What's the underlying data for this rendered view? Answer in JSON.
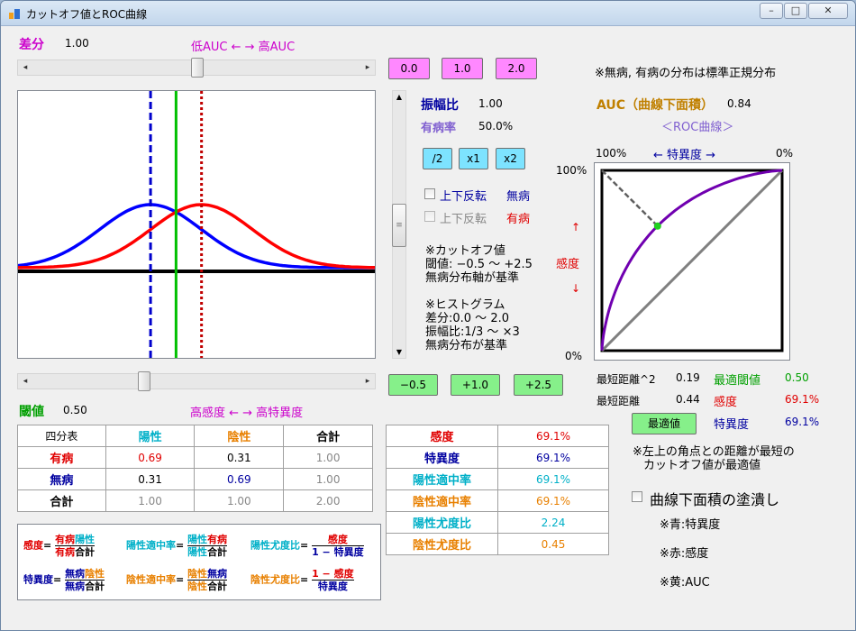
{
  "window": {
    "title": "カットオフ値とROC曲線",
    "min": "▭",
    "max": "▢",
    "close": "✕"
  },
  "diff": {
    "label": "差分",
    "value": "1.00",
    "range": "低AUC ← → 高AUC",
    "buttons": [
      "0.0",
      "1.0",
      "2.0"
    ],
    "slider": 0.5
  },
  "note_dist": "※無病, 有病の分布は標準正規分布",
  "amp": {
    "label": "振幅比",
    "value": "1.00",
    "buttons": [
      "/2",
      "x1",
      "x2"
    ]
  },
  "prev": {
    "label": "有病率",
    "value": "50.0%"
  },
  "flip1": {
    "label": "上下反転",
    "target": "無病"
  },
  "flip2": {
    "label": "上下反転",
    "target": "有病"
  },
  "notes_mid": [
    "※カットオフ値",
    "閾値: −0.5 〜 +2.5",
    "無病分布軸が基準",
    "",
    "※ヒストグラム",
    "差分:0.0 〜 2.0",
    "振幅比:1/3 〜 ×3",
    "無病分布が基準"
  ],
  "threshold": {
    "label": "閾値",
    "value": "0.50",
    "range": "高感度 ← → 高特異度",
    "buttons": [
      "−0.5",
      "+1.0",
      "+2.5"
    ],
    "slider": 0.333
  },
  "auc": {
    "label": "AUC（曲線下面積）",
    "value": "0.84",
    "roc_title": "＜ROC曲線＞"
  },
  "roc": {
    "top_left": "100%",
    "spec_axis": "← 特異度 →",
    "top_right": "0%",
    "y_top": "100%",
    "y_bottom": "0%",
    "sens_axis_up": "↑",
    "sens_axis": "感度",
    "sens_axis_down": "↓",
    "point": {
      "fpr": 0.309,
      "tpr": 0.691
    }
  },
  "stats": {
    "min_dist2_label": "最短距離^2",
    "min_dist2": "0.19",
    "best_thr_label": "最適閾値",
    "best_thr": "0.50",
    "min_dist_label": "最短距離",
    "min_dist": "0.44",
    "sens_label": "感度",
    "sens": "69.1%",
    "best_btn": "最適値",
    "spec_label": "特異度",
    "spec": "69.1%"
  },
  "note_best": [
    "※左上の角点との距離が最短の",
    "カットオフ値が最適値"
  ],
  "fill": {
    "label": "曲線下面積の塗潰し"
  },
  "legend_notes": [
    "※青:特異度",
    "※赤:感度",
    "※黄:AUC"
  ],
  "table4": {
    "header": [
      "四分表",
      "陽性",
      "陰性",
      "合計"
    ],
    "rows": [
      [
        "有病",
        "0.69",
        "0.31",
        "1.00"
      ],
      [
        "無病",
        "0.31",
        "0.69",
        "1.00"
      ],
      [
        "合計",
        "1.00",
        "1.00",
        "2.00"
      ]
    ]
  },
  "metrics": [
    [
      "感度",
      "69.1%"
    ],
    [
      "特異度",
      "69.1%"
    ],
    [
      "陽性適中率",
      "69.1%"
    ],
    [
      "陰性適中率",
      "69.1%"
    ],
    [
      "陽性尤度比",
      "2.24"
    ],
    [
      "陰性尤度比",
      "0.45"
    ]
  ],
  "formulas": {
    "sens": "感度",
    "spec": "特異度",
    "ppv": "陽性適中率",
    "npv": "陰性適中率",
    "plr": "陽性尤度比",
    "nlr": "陰性尤度比",
    "eq": "=",
    "byouki": "有病",
    "mubyou": "無病",
    "yousei": "陽性",
    "insei": "陰性",
    "goukei": "合計",
    "one_minus_spec": "1 − 特異度",
    "one_minus_sens": "1 − 感度"
  },
  "chart_data": {
    "type": "line",
    "series": [
      {
        "name": "無病",
        "color": "#0000ff",
        "mean": 0.0,
        "sd": 1.0
      },
      {
        "name": "有病",
        "color": "#ff0000",
        "mean": 1.0,
        "sd": 1.0
      }
    ],
    "lines": [
      {
        "name": "無病平均",
        "x": 0.0,
        "color": "#0000cc",
        "style": "dashed"
      },
      {
        "name": "閾値",
        "x": 0.5,
        "color": "#00c000",
        "style": "solid"
      },
      {
        "name": "有病平均",
        "x": 1.0,
        "color": "#c00000",
        "style": "dotted"
      }
    ],
    "xlim": [
      -2.6,
      4.4
    ]
  }
}
